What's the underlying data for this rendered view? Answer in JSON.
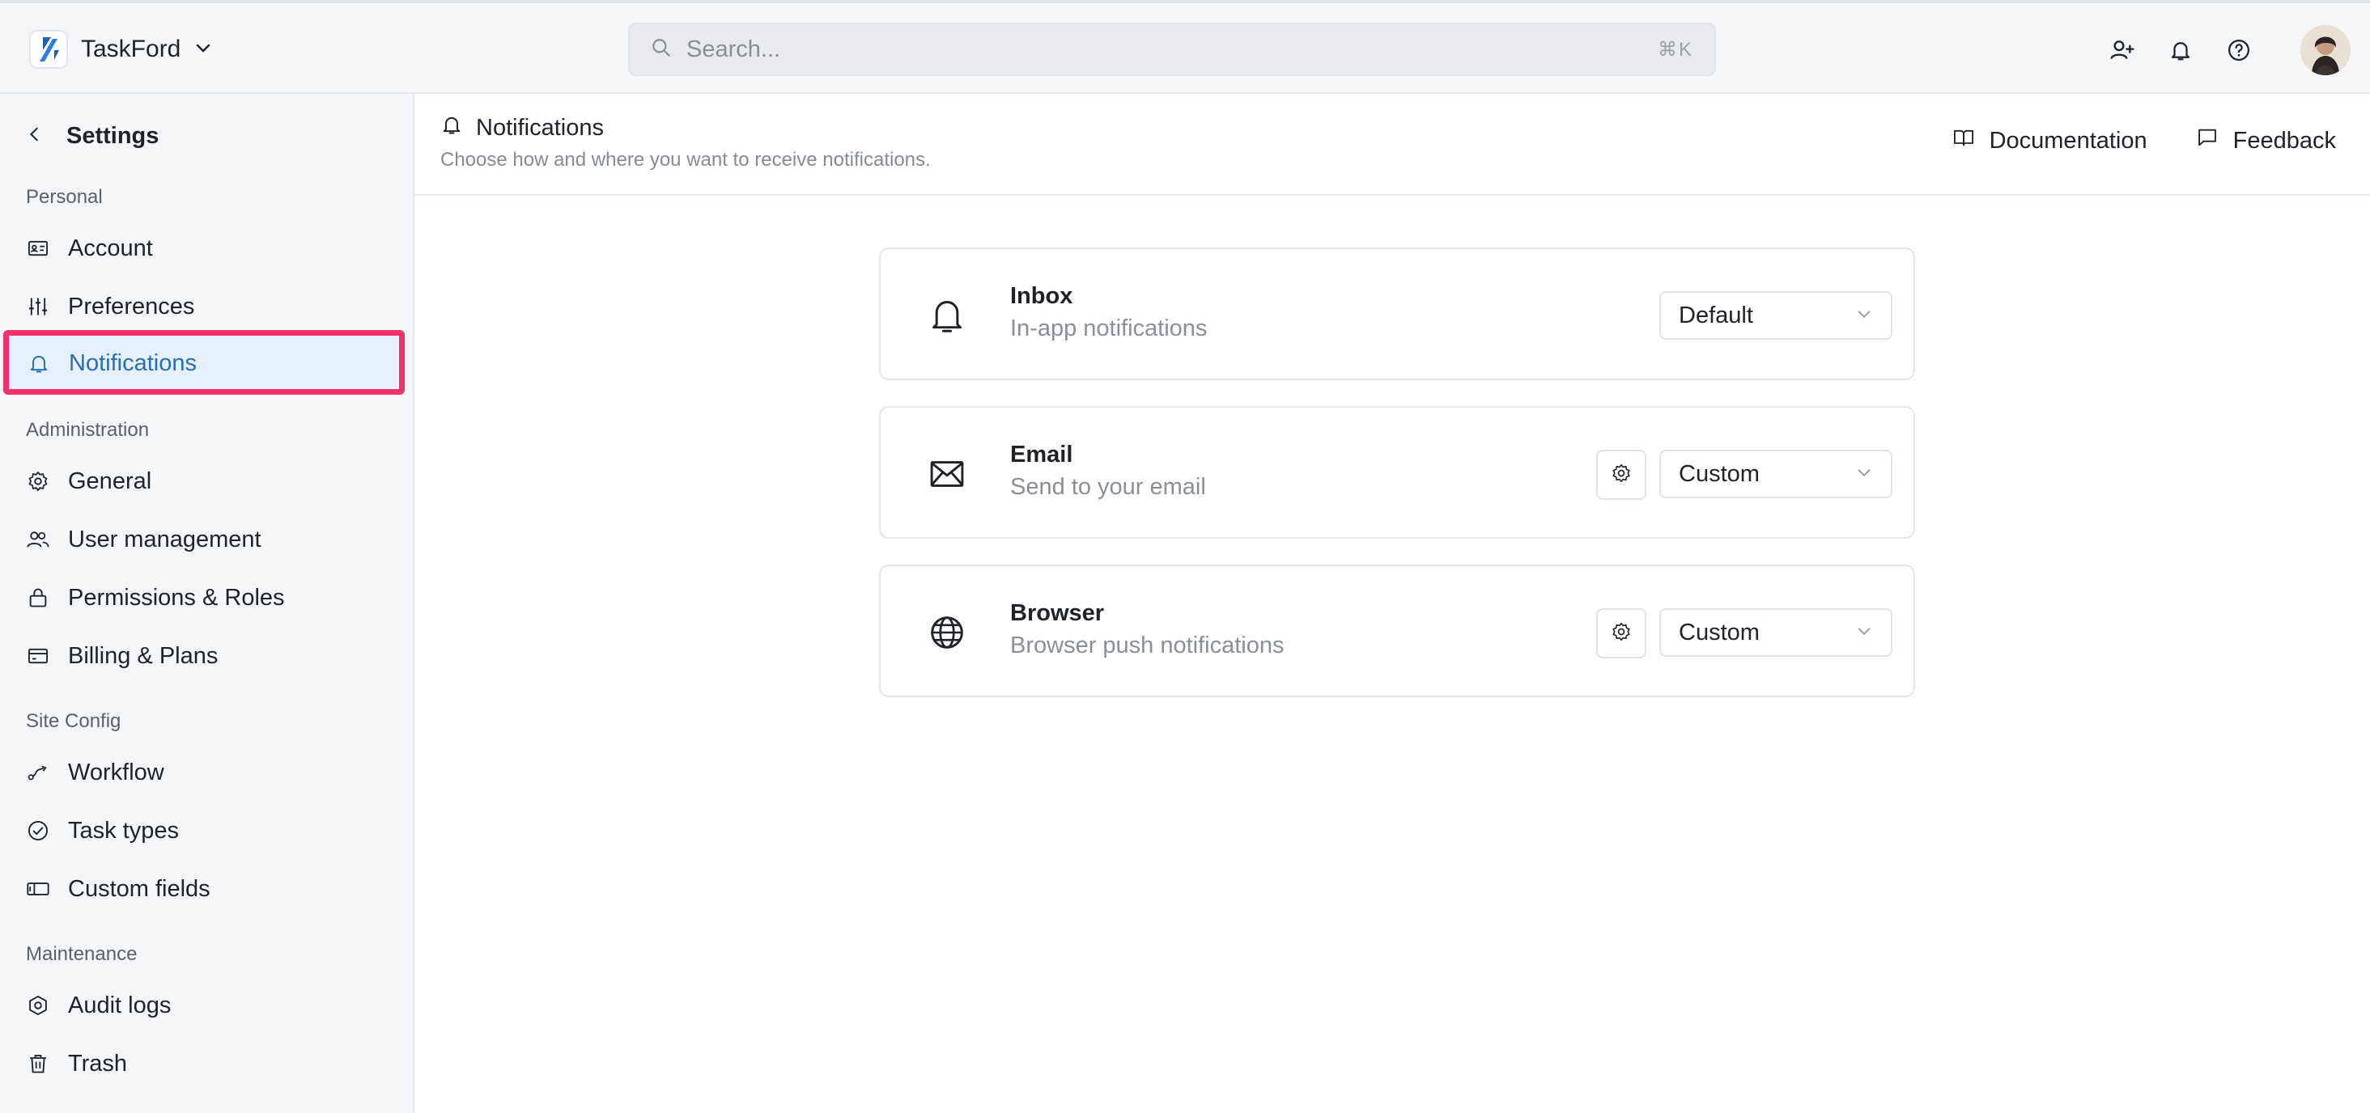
{
  "app": {
    "name": "TaskFord"
  },
  "search": {
    "placeholder": "Search...",
    "shortcut": "⌘K"
  },
  "sidebar": {
    "title": "Settings",
    "sections": [
      {
        "label": "Personal"
      },
      {
        "label": "Administration"
      },
      {
        "label": "Site Config"
      },
      {
        "label": "Maintenance"
      }
    ],
    "items": [
      {
        "label": "Account",
        "icon": "id-card-icon"
      },
      {
        "label": "Preferences",
        "icon": "sliders-icon"
      },
      {
        "label": "Notifications",
        "icon": "bell-icon",
        "active": true
      },
      {
        "label": "General",
        "icon": "gear-icon"
      },
      {
        "label": "User management",
        "icon": "users-icon"
      },
      {
        "label": "Permissions & Roles",
        "icon": "lock-icon"
      },
      {
        "label": "Billing & Plans",
        "icon": "credit-card-icon"
      },
      {
        "label": "Workflow",
        "icon": "workflow-icon"
      },
      {
        "label": "Task types",
        "icon": "check-circle-icon"
      },
      {
        "label": "Custom fields",
        "icon": "custom-field-icon"
      },
      {
        "label": "Audit logs",
        "icon": "hexagon-gear-icon"
      },
      {
        "label": "Trash",
        "icon": "trash-icon"
      }
    ]
  },
  "header": {
    "title": "Notifications",
    "subtitle": "Choose how and where you want to receive notifications.",
    "links": {
      "documentation": "Documentation",
      "feedback": "Feedback"
    }
  },
  "channels": [
    {
      "title": "Inbox",
      "subtitle": "In-app notifications",
      "value": "Default",
      "has_settings": false
    },
    {
      "title": "Email",
      "subtitle": "Send to your email",
      "value": "Custom",
      "has_settings": true
    },
    {
      "title": "Browser",
      "subtitle": "Browser push notifications",
      "value": "Custom",
      "has_settings": true
    }
  ],
  "colors": {
    "accent": "#2a6fb4",
    "highlight_border": "#f0326b",
    "active_bg": "#e5f0fc"
  }
}
